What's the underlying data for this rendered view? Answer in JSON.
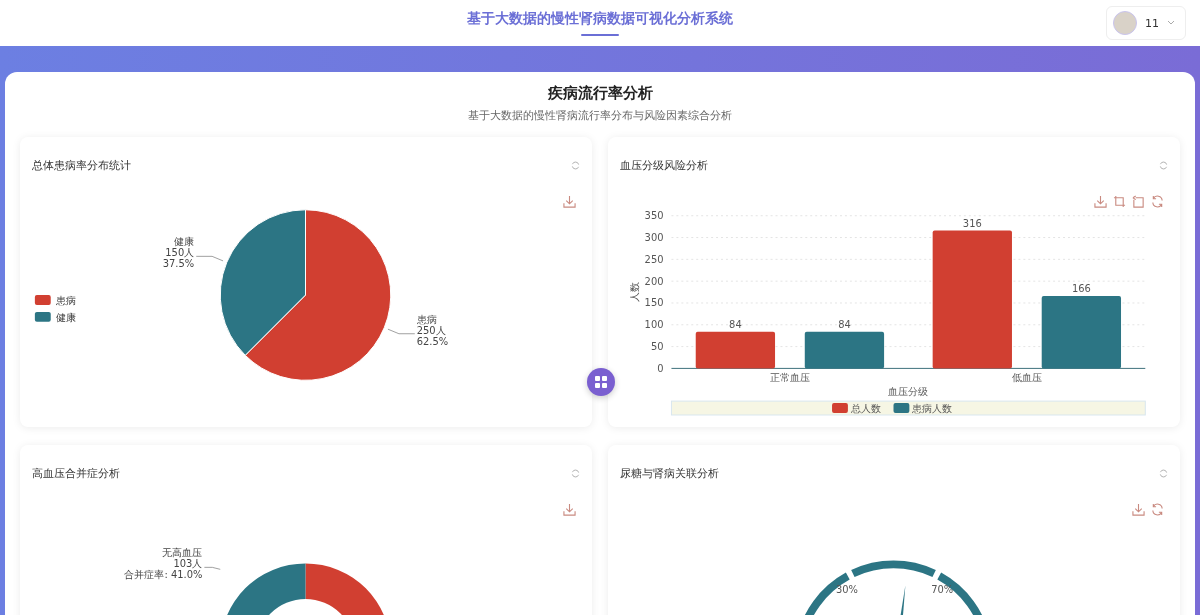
{
  "header": {
    "title": "基于大数据的慢性肾病数据可视化分析系统",
    "user": {
      "name": "11"
    }
  },
  "section": {
    "title": "疾病流行率分析",
    "subtitle": "基于大数据的慢性肾病流行率分布与风险因素综合分析"
  },
  "cards": [
    {
      "kind": "pie",
      "title": "总体患病率分布统计",
      "slice_labels": [
        {
          "name": "患病",
          "count": "250人",
          "share": "62.5%"
        },
        {
          "name": "健康",
          "count": "150人",
          "share": "37.5%"
        }
      ],
      "chart_data": {
        "type": "pie",
        "categories": [
          "患病",
          "健康"
        ],
        "values": [
          62.5,
          37.5
        ],
        "legend": true
      }
    },
    {
      "kind": "bar",
      "title": "血压分级风险分析",
      "chart_data": {
        "type": "bar",
        "xlabel": "血压分级",
        "ylabel": "人数",
        "categories": [
          "正常血压",
          "低血压"
        ],
        "series": [
          {
            "name": "总人数",
            "color": "#d13f31",
            "values": [
              84,
              316
            ]
          },
          {
            "name": "患病人数",
            "color": "#2c7584",
            "values": [
              84,
              166
            ]
          }
        ],
        "ylim": [
          0,
          350
        ],
        "yticks": [
          0,
          50,
          100,
          150,
          200,
          250,
          300,
          350
        ],
        "data_labels": true,
        "grid": true,
        "legend": true
      }
    },
    {
      "kind": "donut",
      "title": "高血压合并症分析",
      "label": [
        "无高血压",
        "103人",
        "合并症率: 41.0%"
      ]
    },
    {
      "kind": "gauge",
      "title": "尿糖与肾病关联分析",
      "tick_labels": [
        "30%",
        "70%"
      ]
    }
  ]
}
